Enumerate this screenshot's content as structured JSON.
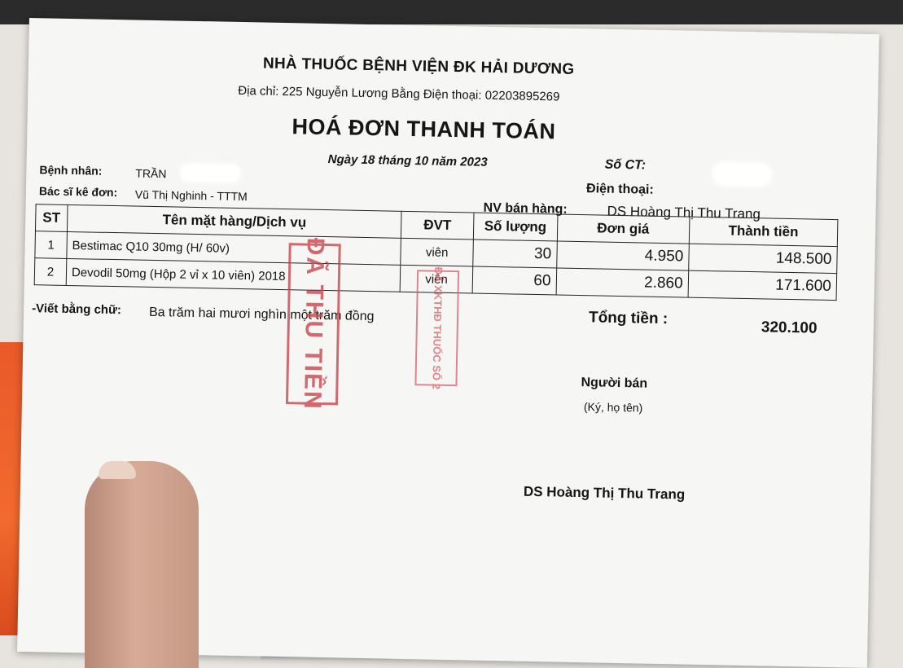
{
  "header": {
    "pharmacy_name": "NHÀ THUỐC  BỆNH VIỆN ĐK HẢI DƯƠNG",
    "address": "Địa chỉ: 225 Nguyễn Lương Bằng   Điện thoại: 02203895269",
    "title": "HOÁ ĐƠN THANH TOÁN",
    "date": "Ngày 18 tháng 10 năm 2023",
    "so_ct_label": "Số CT:"
  },
  "info": {
    "patient_label": "Bệnh nhân:",
    "patient_value": "TRẦN",
    "phone_label": "Điện thoại:",
    "doctor_label": "Bác sĩ kê đơn:",
    "doctor_value": "Vũ Thị Nghinh - TTTM",
    "seller_label": "NV bán hàng:",
    "seller_value": "DS Hoàng Thị Thu Trang"
  },
  "table": {
    "headers": [
      "ST",
      "Tên mặt hàng/Dịch vụ",
      "ĐVT",
      "Số lượng",
      "Đơn giá",
      "Thành tiền"
    ],
    "rows": [
      {
        "st": "1",
        "name": "Bestimac Q10 30mg (H/ 60v)",
        "unit": "viên",
        "qty": "30",
        "price": "4.950",
        "amount": "148.500"
      },
      {
        "st": "2",
        "name": "Devodil 50mg (Hộp 2 vỉ x 10 viên) 2018",
        "unit": "viên",
        "qty": "60",
        "price": "2.860",
        "amount": "171.600"
      }
    ]
  },
  "summary": {
    "words_label": "-Viết bằng chữ:",
    "words_value": "Ba trăm hai mươi nghìn một trăm đồng",
    "total_label": "Tổng tiền :",
    "total_value": "320.100"
  },
  "stamps": {
    "paid": "ĐÃ THU TIỀN",
    "pharmacy_no": "ĐÃ XKTHĐ THUỐC SỐ 2"
  },
  "signature": {
    "role": "Người bán",
    "note": "(Ký, họ tên)",
    "name": "DS Hoàng Thị Thu Trang"
  }
}
